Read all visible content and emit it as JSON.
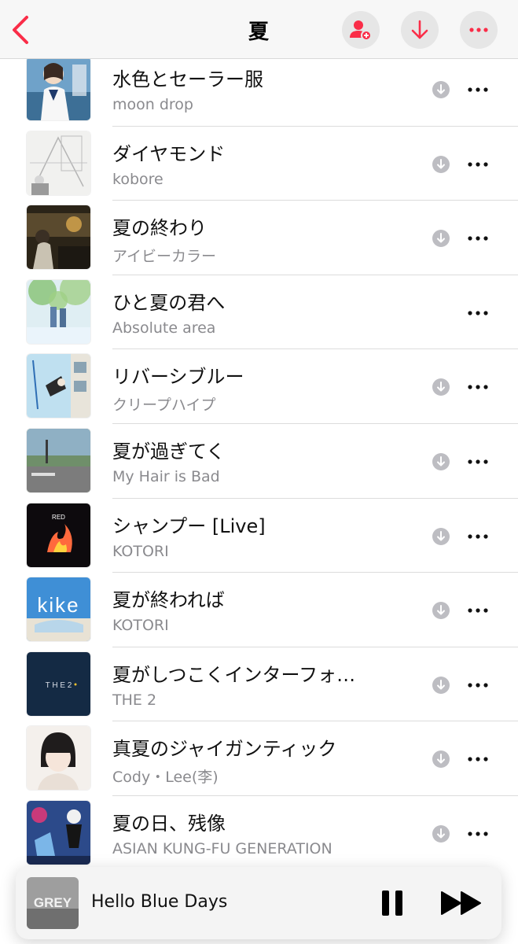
{
  "header": {
    "title": "夏",
    "back_icon": "chevron-left-icon",
    "accent_color": "#fa2d48"
  },
  "songs": [
    {
      "title": "水色とセーラー服",
      "artist": "moon drop",
      "downloadable": true
    },
    {
      "title": "ダイヤモンド",
      "artist": "kobore",
      "downloadable": true
    },
    {
      "title": "夏の終わり",
      "artist": "アイビーカラー",
      "downloadable": true
    },
    {
      "title": "ひと夏の君へ",
      "artist": "Absolute area",
      "downloadable": false
    },
    {
      "title": "リバーシブルー",
      "artist": "クリープハイプ",
      "downloadable": true
    },
    {
      "title": "夏が過ぎてく",
      "artist": "My Hair is Bad",
      "downloadable": true
    },
    {
      "title": "シャンプー [Live]",
      "artist": "KOTORI",
      "downloadable": true
    },
    {
      "title": "夏が終われば",
      "artist": "KOTORI",
      "downloadable": true
    },
    {
      "title": "夏がしつこくインターフォ…",
      "artist": "THE 2",
      "downloadable": true
    },
    {
      "title": "真夏のジャイガンティック",
      "artist": "Cody・Lee(李)",
      "downloadable": true
    },
    {
      "title": "夏の日、残像",
      "artist": "ASIAN KUNG-FU GENERATION",
      "downloadable": true
    }
  ],
  "artwork_text": {
    "red": "RED",
    "kike": "kike",
    "the2": "T H E  2",
    "grey": "GREY"
  },
  "mini_player": {
    "title": "Hello Blue Days",
    "state": "playing"
  }
}
